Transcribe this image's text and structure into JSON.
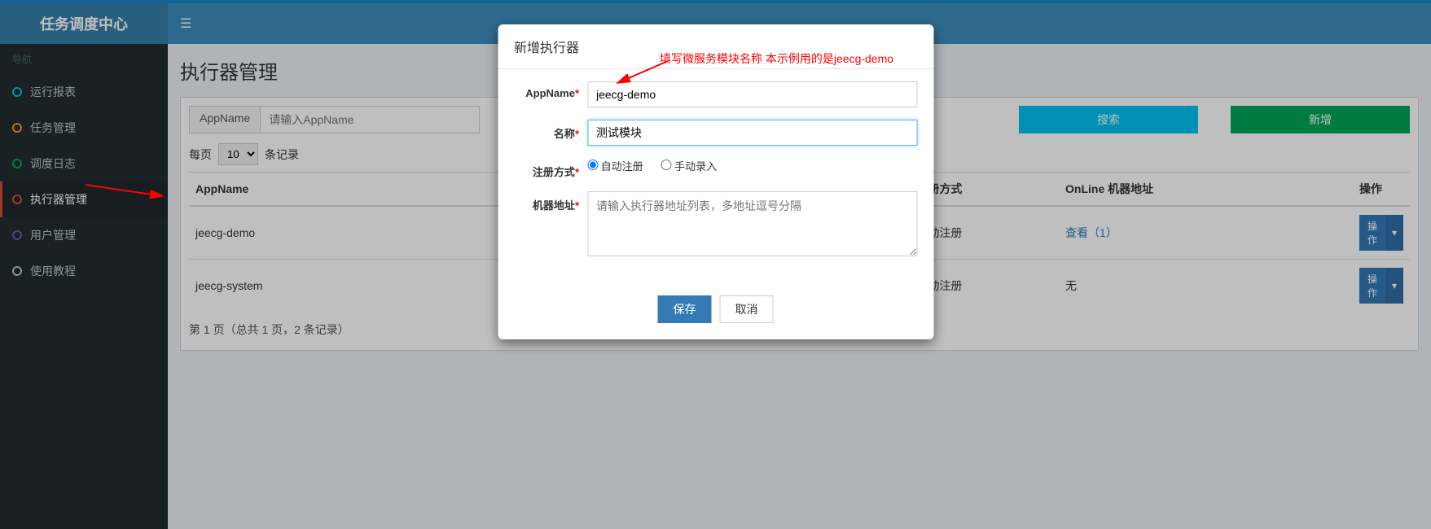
{
  "header": {
    "logo": "任务调度中心"
  },
  "sidebar": {
    "section": "导航",
    "items": [
      {
        "label": "运行报表",
        "dot": "aqua"
      },
      {
        "label": "任务管理",
        "dot": "yellow"
      },
      {
        "label": "调度日志",
        "dot": "green"
      },
      {
        "label": "执行器管理",
        "dot": "red",
        "active": true
      },
      {
        "label": "用户管理",
        "dot": "purple"
      },
      {
        "label": "使用教程",
        "dot": "gray"
      }
    ]
  },
  "page": {
    "title": "执行器管理",
    "search_label": "AppName",
    "search_placeholder": "请输入AppName",
    "search_btn": "搜索",
    "add_btn": "新增",
    "perpage_prefix": "每页",
    "perpage_value": "10",
    "perpage_suffix": "条记录",
    "columns": {
      "appname": "AppName",
      "regtype": "册方式",
      "online": "OnLine 机器地址",
      "ops": "操作"
    },
    "rows": [
      {
        "appname": "jeecg-demo",
        "regtype": "动注册",
        "online": "查看（1）",
        "online_is_link": true
      },
      {
        "appname": "jeecg-system",
        "regtype": "动注册",
        "online": "无",
        "online_is_link": false
      }
    ],
    "op_btn": "操作",
    "pager": "第 1 页（总共 1 页，2 条记录）"
  },
  "modal": {
    "title": "新增执行器",
    "labels": {
      "appname": "AppName",
      "name": "名称",
      "regtype": "注册方式",
      "addr": "机器地址"
    },
    "appname_value": "jeecg-demo",
    "name_value": "测试模块",
    "radio_auto": "自动注册",
    "radio_manual": "手动录入",
    "addr_placeholder": "请输入执行器地址列表，多地址逗号分隔",
    "save": "保存",
    "cancel": "取消"
  },
  "annotation": {
    "text": "填写微服务模块名称 本示例用的是jeecg-demo"
  }
}
